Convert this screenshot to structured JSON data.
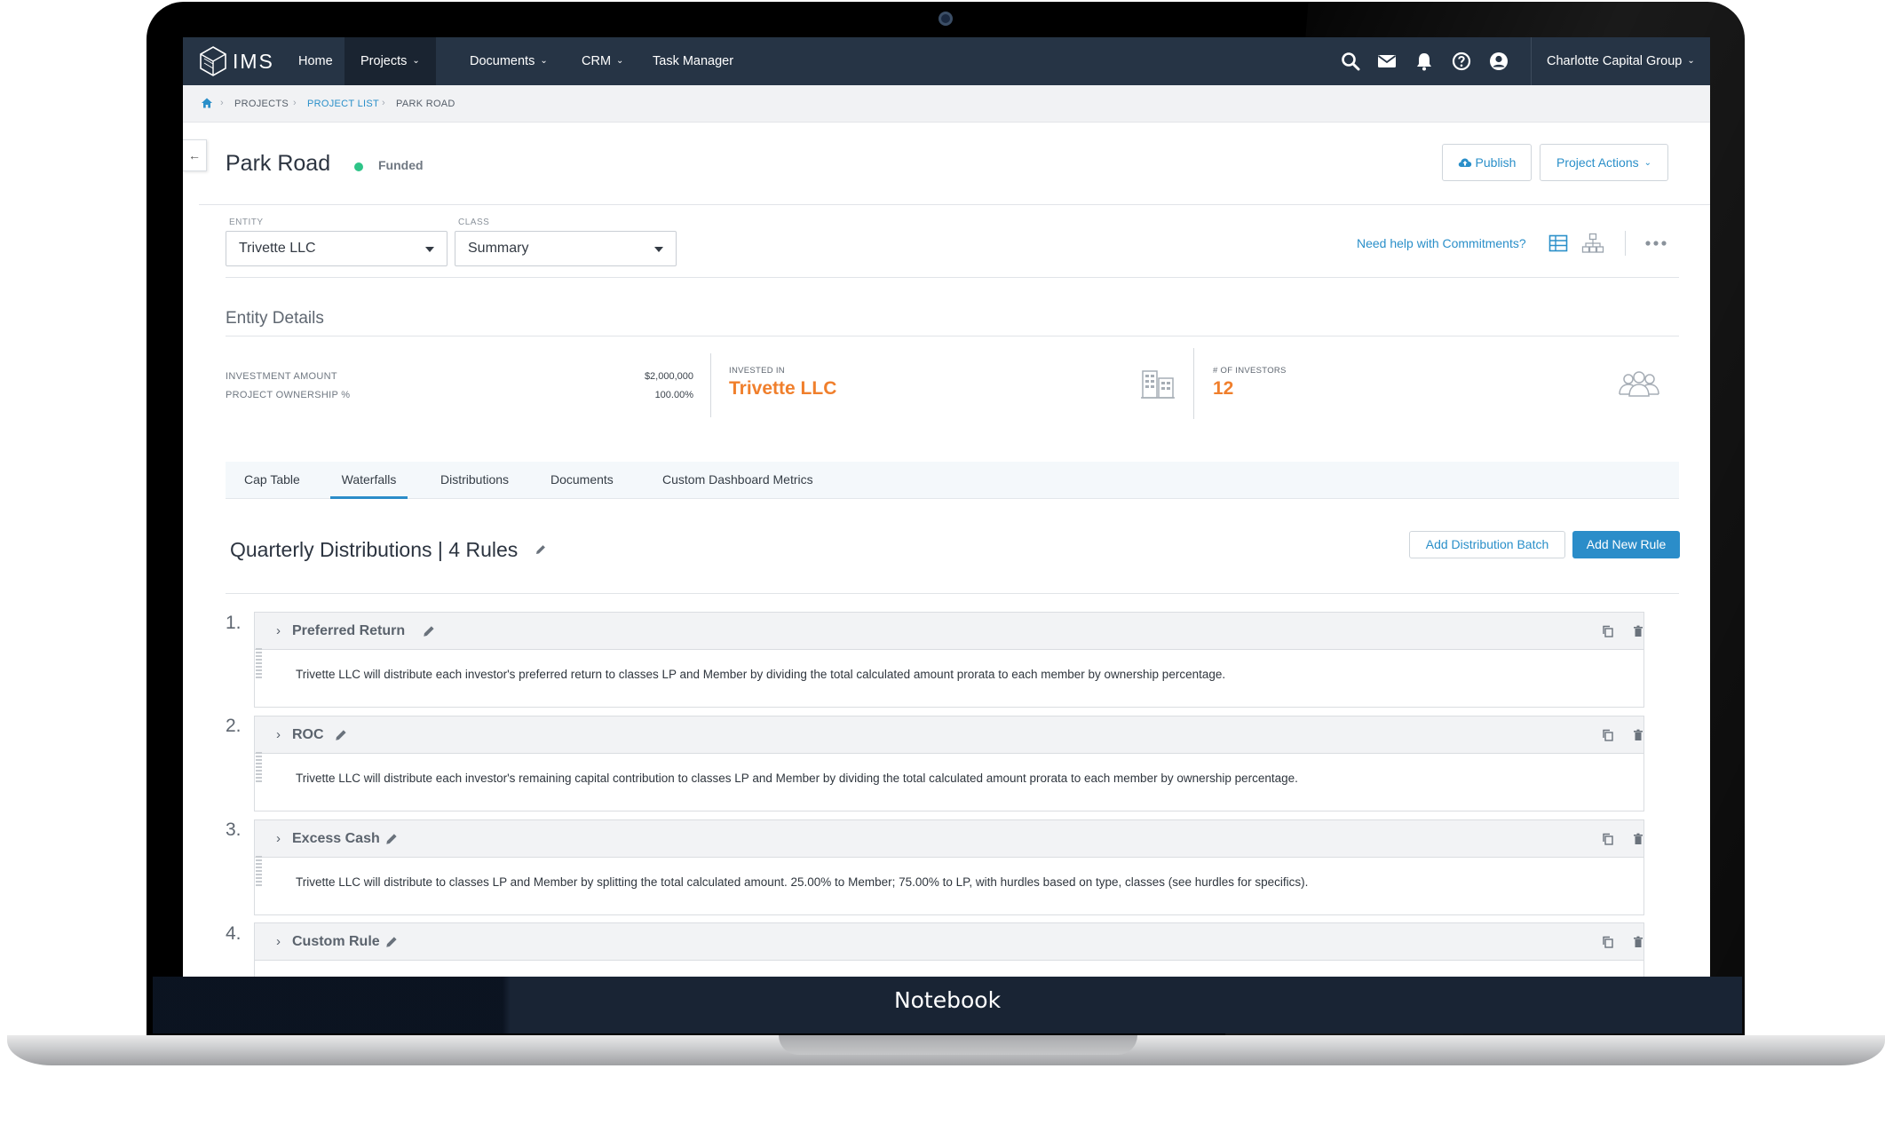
{
  "device_label": "Notebook",
  "nav": {
    "logo_text": "IMS",
    "items": [
      {
        "label": "Home",
        "has_menu": false
      },
      {
        "label": "Projects",
        "has_menu": true
      },
      {
        "label": "Documents",
        "has_menu": true
      },
      {
        "label": "CRM",
        "has_menu": true
      },
      {
        "label": "Task Manager",
        "has_menu": false
      }
    ],
    "icons": [
      "search-icon",
      "mail-icon",
      "bell-icon",
      "help-icon",
      "user-icon"
    ],
    "org_name": "Charlotte Capital Group"
  },
  "breadcrumb": {
    "items": [
      "PROJECTS",
      "PROJECT LIST",
      "PARK ROAD"
    ]
  },
  "header": {
    "title": "Park Road",
    "status": "Funded",
    "publish_label": "Publish",
    "actions_label": "Project Actions"
  },
  "filters": {
    "entity_label": "ENTITY",
    "entity_value": "Trivette LLC",
    "class_label": "CLASS",
    "class_value": "Summary",
    "help_text": "Need help with Commitments?"
  },
  "entity_details": {
    "title": "Entity Details",
    "investment_amount_label": "INVESTMENT AMOUNT",
    "investment_amount_value": "$2,000,000",
    "ownership_label": "PROJECT OWNERSHIP %",
    "ownership_value": "100.00%",
    "invested_in_label": "INVESTED IN",
    "invested_in_value": "Trivette LLC",
    "investors_label": "# OF INVESTORS",
    "investors_value": "12"
  },
  "tabs": [
    {
      "label": "Cap Table",
      "active": false
    },
    {
      "label": "Waterfalls",
      "active": true
    },
    {
      "label": "Distributions",
      "active": false
    },
    {
      "label": "Documents",
      "active": false
    },
    {
      "label": "Custom Dashboard Metrics",
      "active": false
    }
  ],
  "distributions": {
    "title": "Quarterly Distributions | 4 Rules",
    "add_batch_label": "Add Distribution Batch",
    "add_rule_label": "Add New Rule",
    "rules": [
      {
        "number": "1.",
        "name": "Preferred Return",
        "description": "Trivette LLC will distribute each investor's preferred return to classes LP and Member by dividing the total calculated amount prorata to each member by ownership percentage."
      },
      {
        "number": "2.",
        "name": "ROC",
        "description": "Trivette LLC will distribute each investor's remaining capital contribution to classes LP and Member by dividing the total calculated amount prorata to each member by ownership percentage."
      },
      {
        "number": "3.",
        "name": "Excess Cash",
        "description": "Trivette LLC will distribute to classes LP and Member by splitting the total calculated amount. 25.00% to Member; 75.00% to LP, with hurdles based on type, classes (see hurdles for specifics)."
      },
      {
        "number": "4.",
        "name": "Custom Rule",
        "description": ""
      }
    ]
  },
  "colors": {
    "nav_bg": "#263445",
    "accent": "#2b8dc9",
    "highlight": "#f07f2c",
    "status_green": "#2ec488"
  }
}
